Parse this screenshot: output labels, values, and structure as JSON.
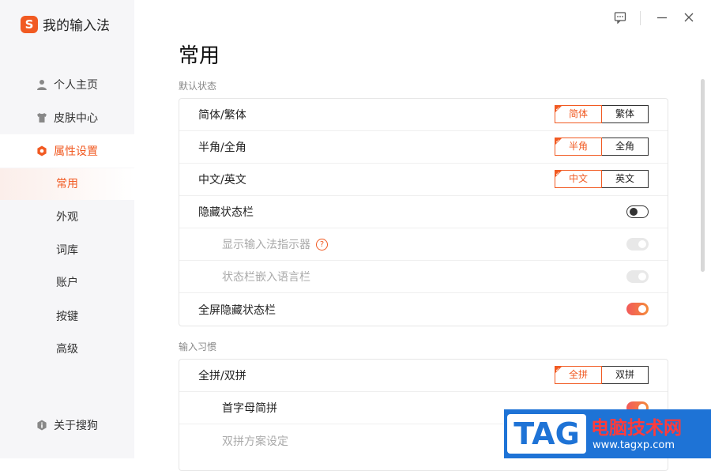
{
  "app": {
    "logo_letter": "S",
    "title": "我的输入法"
  },
  "sidebar": {
    "items": [
      {
        "label": "个人主页",
        "icon": "user-icon"
      },
      {
        "label": "皮肤中心",
        "icon": "tshirt-icon"
      },
      {
        "label": "属性设置",
        "icon": "settings-icon"
      }
    ],
    "sub_items": [
      "常用",
      "外观",
      "词库",
      "账户",
      "按键",
      "高级"
    ],
    "active_sub": "常用",
    "about": "关于搜狗"
  },
  "main": {
    "title": "常用",
    "sections": [
      {
        "label": "默认状态",
        "rows": [
          {
            "label": "简体/繁体",
            "control": "segment",
            "options": [
              "简体",
              "繁体"
            ],
            "selected": 0
          },
          {
            "label": "半角/全角",
            "control": "segment",
            "options": [
              "半角",
              "全角"
            ],
            "selected": 0
          },
          {
            "label": "中文/英文",
            "control": "segment",
            "options": [
              "中文",
              "英文"
            ],
            "selected": 0
          },
          {
            "label": "隐藏状态栏",
            "control": "toggle",
            "state": "off"
          },
          {
            "label": "显示输入法指示器",
            "control": "toggle",
            "state": "disabled",
            "help": "?"
          },
          {
            "label": "状态栏嵌入语言栏",
            "control": "toggle",
            "state": "disabled"
          },
          {
            "label": "全屏隐藏状态栏",
            "control": "toggle",
            "state": "on"
          }
        ]
      },
      {
        "label": "输入习惯",
        "rows": [
          {
            "label": "全拼/双拼",
            "control": "segment",
            "options": [
              "全拼",
              "双拼"
            ],
            "selected": 0
          },
          {
            "label": "首字母简拼",
            "control": "toggle",
            "state": "on"
          },
          {
            "label": "双拼方案设定"
          }
        ]
      }
    ]
  },
  "watermark": {
    "tag": "TAG",
    "title": "电脑技术网",
    "url": "www.tagxp.com"
  },
  "colors": {
    "accent": "#f15a22",
    "sidebar_bg": "#f6f6f8"
  }
}
